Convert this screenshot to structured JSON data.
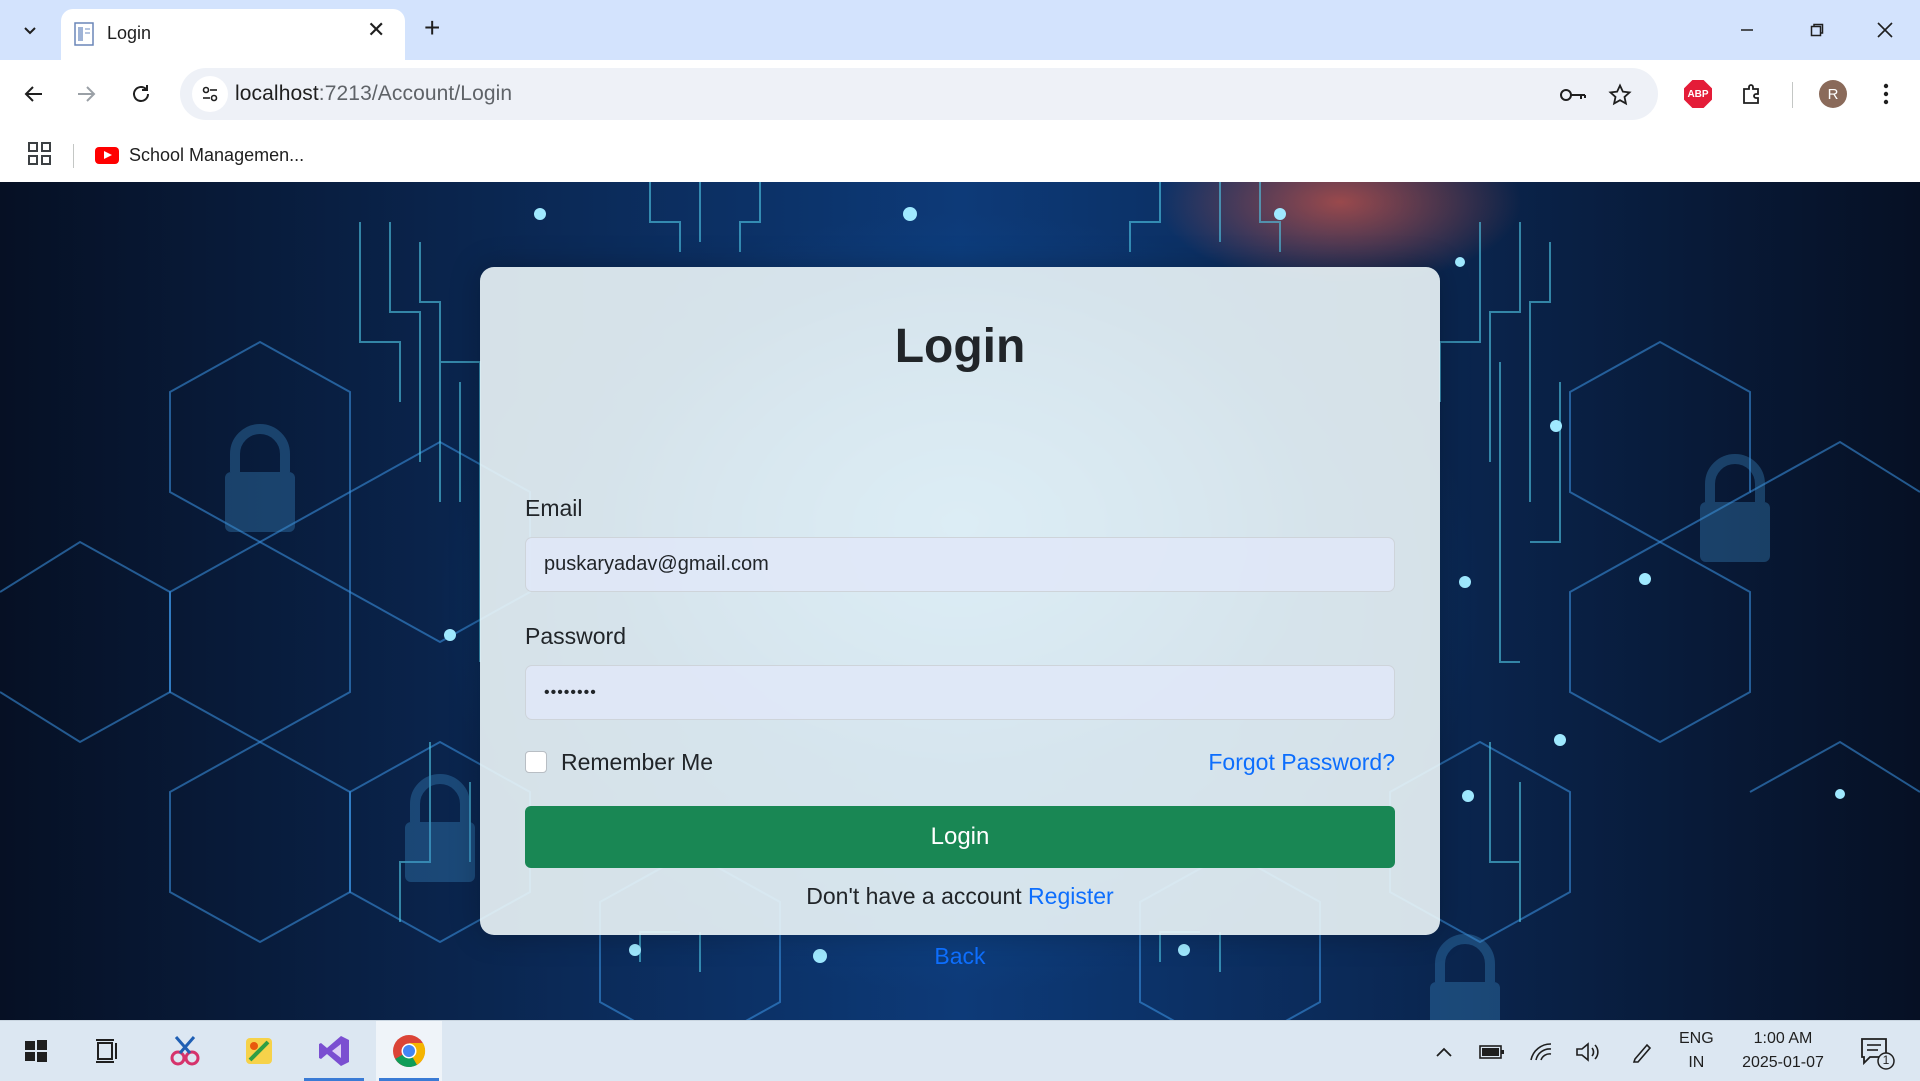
{
  "browser": {
    "tab_title": "Login",
    "url_host": "localhost",
    "url_rest": ":7213/Account/Login",
    "bookmark_label": "School Managemen..."
  },
  "extensions": {
    "abp_label": "ABP",
    "profile_initial": "R"
  },
  "login": {
    "title": "Login",
    "email_label": "Email",
    "email_value": "puskaryadav@gmail.com",
    "password_label": "Password",
    "password_value": "••••••••",
    "remember_label": "Remember Me",
    "remember_checked": false,
    "forgot_label": "Forgot Password?",
    "submit_label": "Login",
    "no_account_text": "Don't have a account",
    "register_label": "Register",
    "back_label": "Back"
  },
  "taskbar": {
    "lang_top": "ENG",
    "lang_bottom": "IN",
    "time": "1:00 AM",
    "date": "2025-01-07",
    "notification_count": "1"
  },
  "colors": {
    "accent_link": "#0d6efd",
    "login_button": "#198754",
    "tabstrip": "#d3e3fd"
  }
}
